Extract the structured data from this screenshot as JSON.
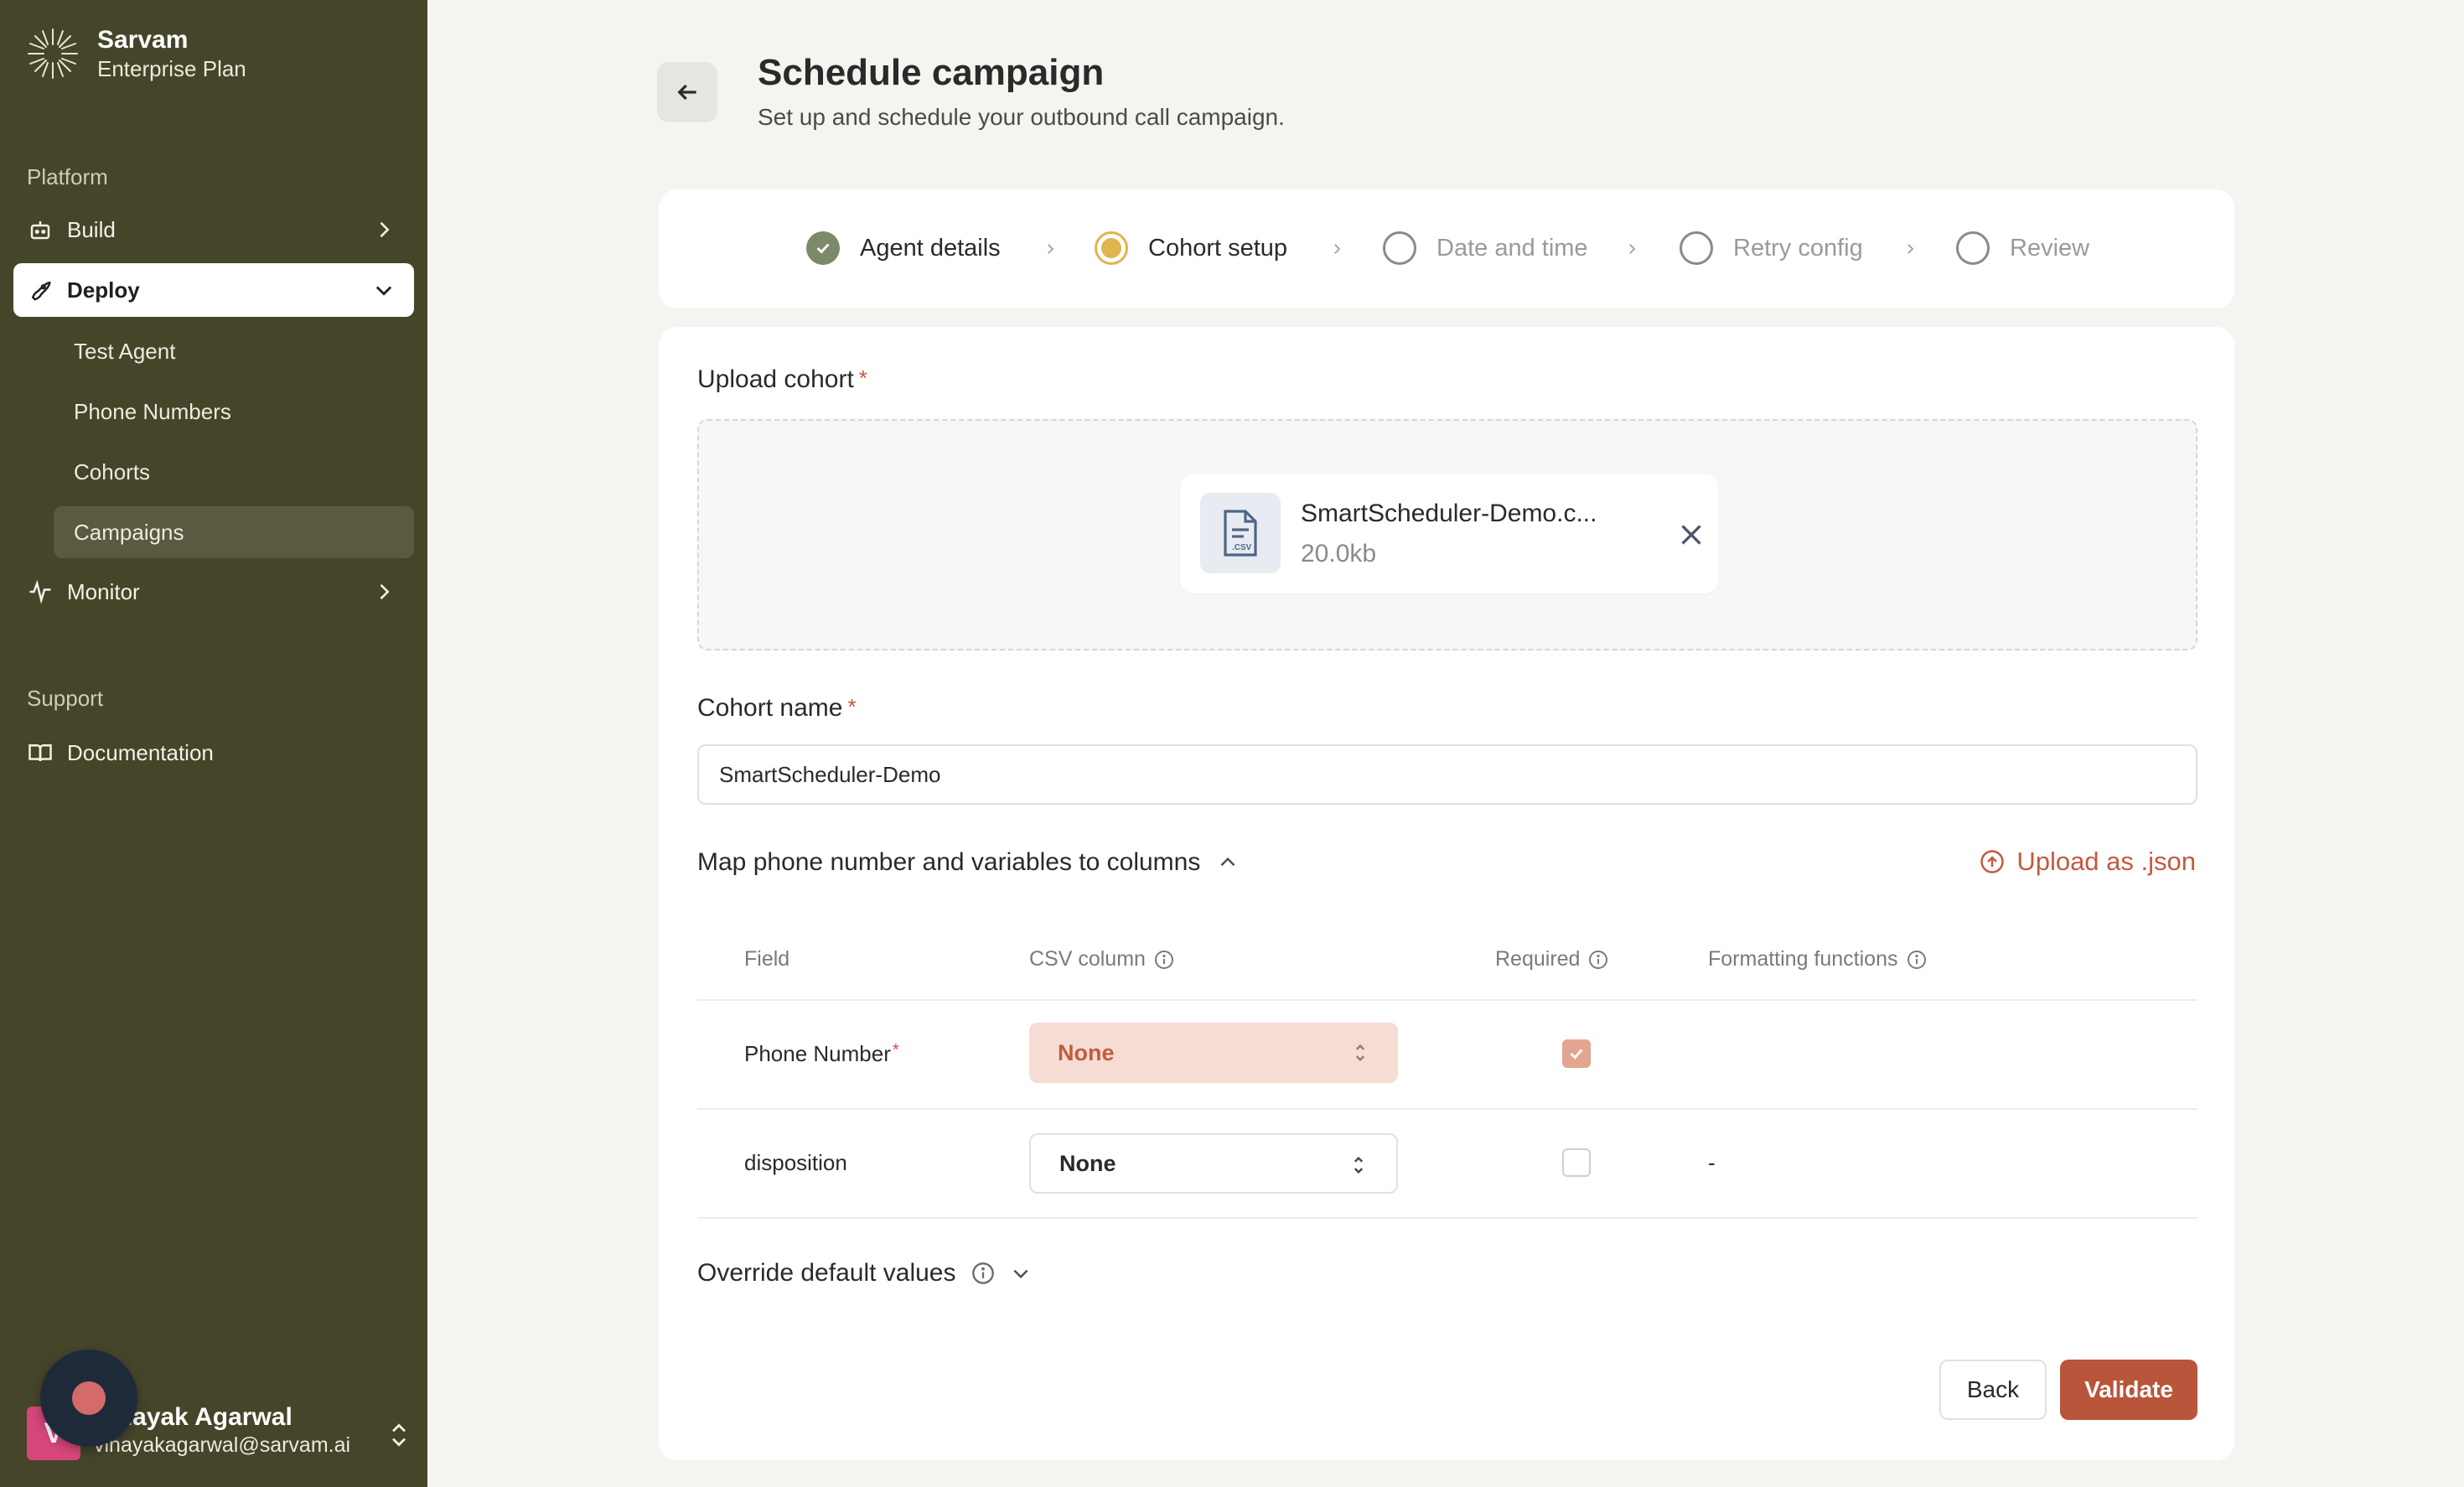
{
  "brand": {
    "name": "Sarvam",
    "plan": "Enterprise Plan"
  },
  "sidebar": {
    "platform_label": "Platform",
    "build": "Build",
    "deploy": "Deploy",
    "deploy_items": [
      "Test Agent",
      "Phone Numbers",
      "Cohorts",
      "Campaigns"
    ],
    "monitor": "Monitor",
    "support_label": "Support",
    "documentation": "Documentation"
  },
  "user": {
    "initial": "V",
    "name": "Vinayak Agarwal",
    "email": "vinayakagarwal@sarvam.ai"
  },
  "header": {
    "title": "Schedule campaign",
    "subtitle": "Set up and schedule your outbound call campaign."
  },
  "steps": [
    {
      "label": "Agent details",
      "state": "done"
    },
    {
      "label": "Cohort setup",
      "state": "current"
    },
    {
      "label": "Date and time",
      "state": "pending"
    },
    {
      "label": "Retry config",
      "state": "pending"
    },
    {
      "label": "Review",
      "state": "pending"
    }
  ],
  "upload": {
    "label": "Upload cohort",
    "required_mark": "*",
    "file_name": "SmartScheduler-Demo.c...",
    "file_size": "20.0kb",
    "file_type": ".CSV"
  },
  "cohort": {
    "label": "Cohort name",
    "required_mark": "*",
    "value": "SmartScheduler-Demo"
  },
  "mapping": {
    "title": "Map phone number and variables to columns",
    "upload_json": "Upload as .json",
    "columns": {
      "field": "Field",
      "csv_column": "CSV column",
      "required": "Required",
      "formatting": "Formatting functions"
    },
    "rows": [
      {
        "field": "Phone Number",
        "required_mark": "*",
        "csv_value": "None",
        "required": true,
        "formatting": ""
      },
      {
        "field": "disposition",
        "required_mark": "",
        "csv_value": "None",
        "required": false,
        "formatting": "-"
      }
    ]
  },
  "override": {
    "label": "Override default values"
  },
  "buttons": {
    "back": "Back",
    "validate": "Validate"
  },
  "colors": {
    "sidebar_bg": "#45452a",
    "accent": "#b8553b",
    "step_done": "#7d8a6a",
    "step_current": "#e0b44e"
  }
}
